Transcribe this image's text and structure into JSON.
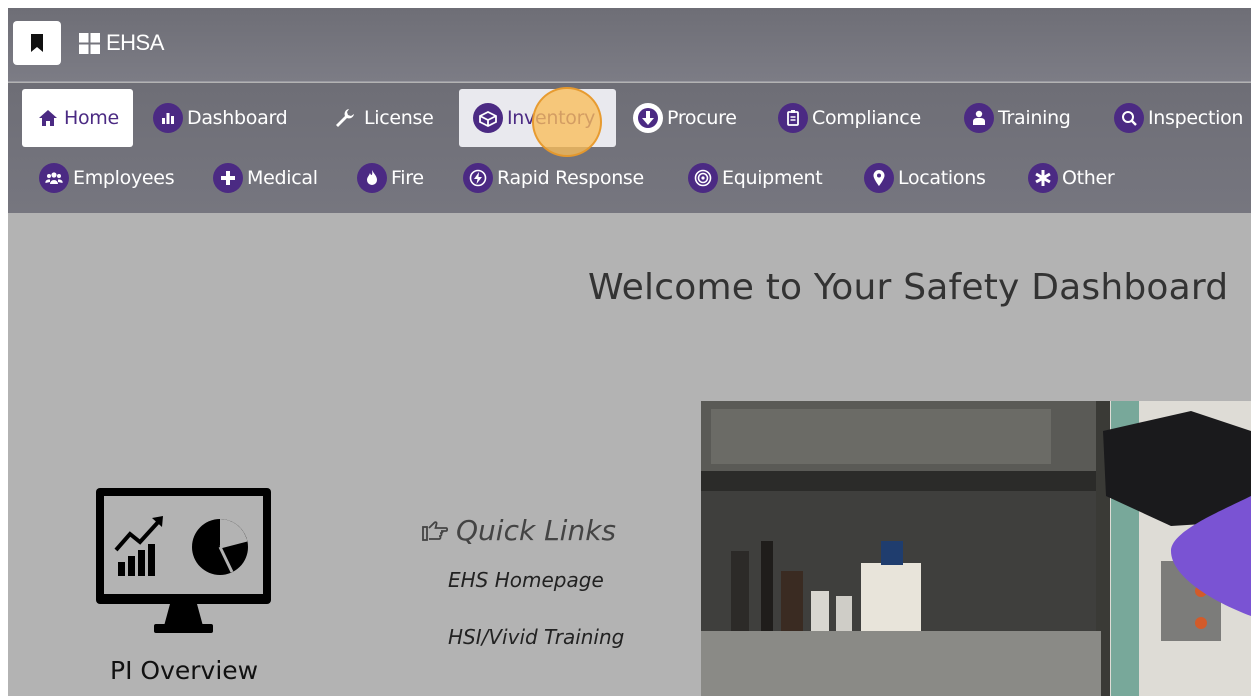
{
  "app": {
    "title": "EHSA"
  },
  "icons": {
    "bookmark": "bookmark-icon",
    "grid": "grid-icon"
  },
  "colors": {
    "accent": "#4b2a83",
    "topbar": "#72727b",
    "content_bg": "#b3b3b3",
    "cursor_highlight": "#fbbd5a"
  },
  "nav": {
    "row1": [
      {
        "label": "Home",
        "icon": "home-icon",
        "state": "active"
      },
      {
        "label": "Dashboard",
        "icon": "bar-chart-icon"
      },
      {
        "label": "License",
        "icon": "wrench-icon"
      },
      {
        "label": "Inventory",
        "icon": "box-icon",
        "state": "hover"
      },
      {
        "label": "Procure",
        "icon": "arrow-down-icon"
      },
      {
        "label": "Compliance",
        "icon": "clipboard-icon"
      },
      {
        "label": "Training",
        "icon": "user-presenter-icon"
      },
      {
        "label": "Inspection",
        "icon": "search-icon"
      }
    ],
    "row2": [
      {
        "label": "Employees",
        "icon": "users-icon"
      },
      {
        "label": "Medical",
        "icon": "plus-icon"
      },
      {
        "label": "Fire",
        "icon": "fire-icon"
      },
      {
        "label": "Rapid Response",
        "icon": "bolt-icon"
      },
      {
        "label": "Equipment",
        "icon": "target-icon"
      },
      {
        "label": "Locations",
        "icon": "map-pin-icon"
      },
      {
        "label": "Other",
        "icon": "asterisk-icon"
      }
    ]
  },
  "main": {
    "welcome": "Welcome to Your Safety Dashboard",
    "pi_overview": {
      "title": "PI Overview",
      "icon": "monitor-chart-icon"
    },
    "quick_links": {
      "title": "Quick Links",
      "icon": "hand-pointer-icon",
      "links": [
        "EHS Homepage",
        "HSI/Vivid Training"
      ]
    },
    "photo": {
      "subject": "lab-scanner-photo"
    }
  }
}
